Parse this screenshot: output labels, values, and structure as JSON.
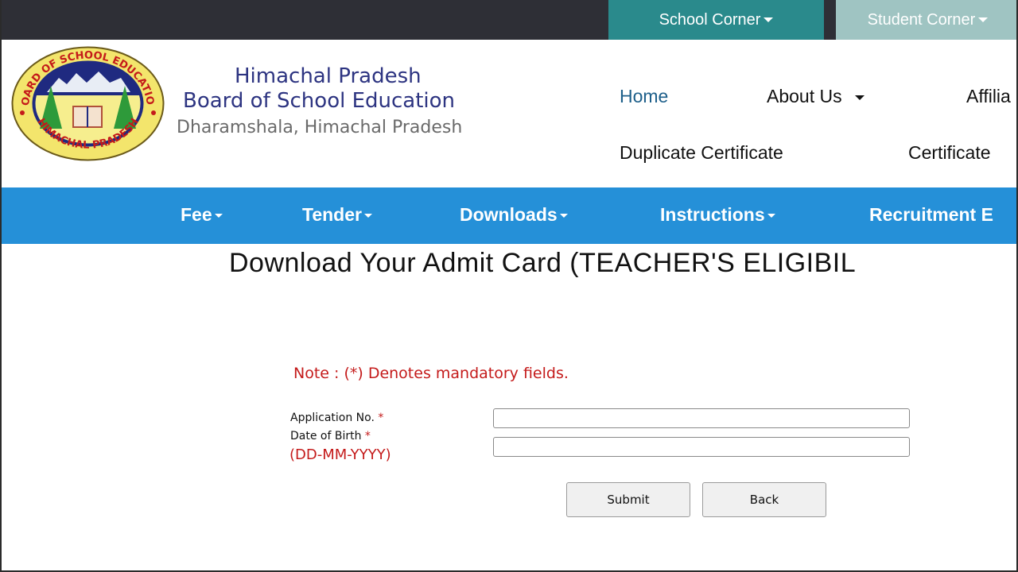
{
  "topbar": {
    "school_corner": "School Corner",
    "student_corner": "Student Corner"
  },
  "header": {
    "logo": {
      "top_text": "BOARD OF SCHOOL EDUCATION",
      "bottom_text": "HIMACHAL PRADESH"
    },
    "brand_line1": "Himachal Pradesh",
    "brand_line2": "Board of School Education",
    "brand_line3": "Dharamshala, Himachal Pradesh",
    "nav": {
      "home": "Home",
      "about": "About Us",
      "affiliation": "Affilia",
      "duplicate_certificate": "Duplicate Certificate",
      "certificate": "Certificate"
    }
  },
  "bluenav": {
    "items": [
      {
        "label": "Fee"
      },
      {
        "label": "Tender"
      },
      {
        "label": "Downloads"
      },
      {
        "label": "Instructions"
      },
      {
        "label": "Recruitment E"
      }
    ]
  },
  "content": {
    "title": "Download Your Admit Card (TEACHER'S ELIGIBIL",
    "note": "Note  : (*) Denotes mandatory fields.",
    "application_label": "Application No.",
    "dob_label": "Date of Birth",
    "required_mark": "*",
    "dob_format": "(DD-MM-YYYY)",
    "application_value": "",
    "dob_value": "",
    "submit_label": "Submit",
    "back_label": "Back"
  },
  "colors": {
    "topbar": "#2e2f36",
    "school_corner": "#2a8a8c",
    "student_corner": "#9fc4c2",
    "brand": "#2d3481",
    "bluenav": "#2590d8",
    "required": "#c41a1a"
  }
}
